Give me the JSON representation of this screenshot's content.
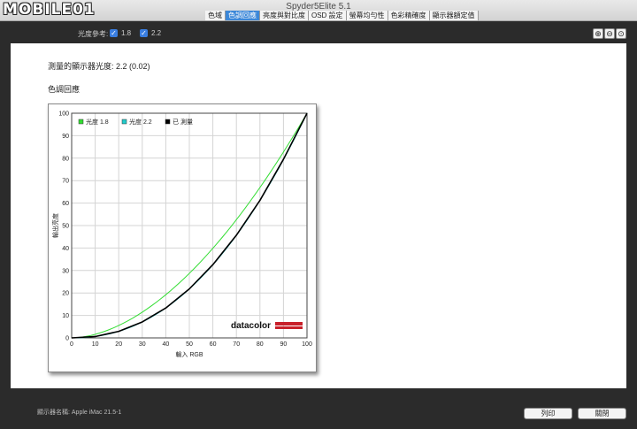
{
  "window": {
    "title": "Spyder5Elite 5.1",
    "logo": "MOBILE01",
    "tabs": [
      "色域",
      "色調回應",
      "亮度與對比度",
      "OSD 設定",
      "螢幕均勻性",
      "色彩精確度",
      "顯示器額定值"
    ],
    "active_tab": 1
  },
  "toolbar": {
    "gamma_label": "光度參考:",
    "option_1": "1.8",
    "option_2": "2.2",
    "zoom_in": "⊕",
    "zoom_out": "⊖",
    "zoom_fit": "⊙"
  },
  "main": {
    "measured_text": "測量的顯示器光度: 2.2 (0.02)",
    "section_title": "色調回應"
  },
  "chart_data": {
    "type": "line",
    "xlabel": "輸入 RGB",
    "ylabel": "輸出亮度",
    "xlim": [
      0,
      100
    ],
    "ylim": [
      0,
      100
    ],
    "xticks": [
      0,
      10,
      20,
      30,
      40,
      50,
      60,
      70,
      80,
      90,
      100
    ],
    "yticks": [
      0,
      10,
      20,
      30,
      40,
      50,
      60,
      70,
      80,
      90,
      100
    ],
    "grid": true,
    "legend_position": "top-left",
    "watermark": "datacolor",
    "series": [
      {
        "name": "光度 1.8",
        "color": "#33dd33",
        "gamma": 1.8
      },
      {
        "name": "光度 2.2",
        "color": "#22cccc",
        "gamma": 2.2
      },
      {
        "name": "已 測量",
        "color": "#000000",
        "x": [
          0,
          10,
          20,
          30,
          40,
          50,
          60,
          70,
          80,
          90,
          100
        ],
        "y": [
          0,
          0.6,
          2.9,
          7.1,
          13.3,
          21.8,
          32.6,
          45.7,
          61.2,
          79.5,
          100
        ]
      }
    ]
  },
  "footer": {
    "device_label": "顯示器名稱: Apple iMac 21.5-1",
    "print_button": "列印",
    "close_button": "關閉"
  }
}
